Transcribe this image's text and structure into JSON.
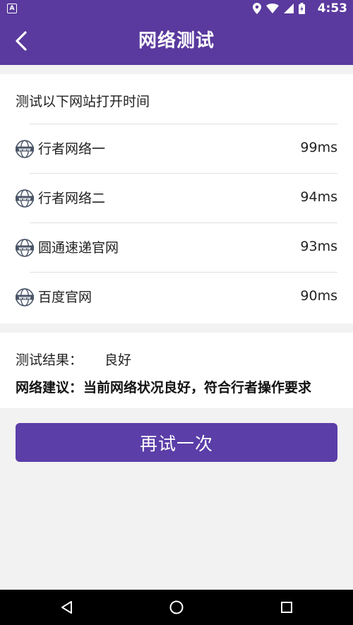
{
  "status_bar": {
    "time": "4:53",
    "notification_letter": "A"
  },
  "app_bar": {
    "title": "网络测试",
    "back_icon": "chevron-left-icon"
  },
  "test_card": {
    "heading": "测试以下网站打开时间",
    "sites": [
      {
        "name": "行者网络一",
        "latency": "99ms",
        "icon": "www-globe-icon"
      },
      {
        "name": "行者网络二",
        "latency": "94ms",
        "icon": "www-globe-icon"
      },
      {
        "name": "圆通速递官网",
        "latency": "93ms",
        "icon": "www-globe-icon"
      },
      {
        "name": "百度官网",
        "latency": "90ms",
        "icon": "www-globe-icon"
      }
    ]
  },
  "result": {
    "label": "测试结果：",
    "value": "良好",
    "advice_label": "网络建议：",
    "advice": "当前网络状况良好，符合行者操作要求"
  },
  "retry_button": {
    "label": "再试一次"
  },
  "colors": {
    "primary": "#5a3a9e",
    "button": "#5b3ea8",
    "background": "#f2f2f2"
  }
}
